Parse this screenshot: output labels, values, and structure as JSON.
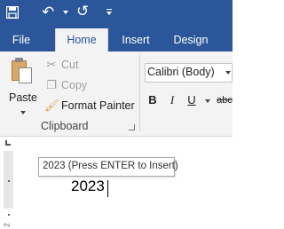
{
  "quick_access": {
    "items": [
      "save-icon",
      "undo-icon",
      "redo-icon",
      "customize-dropdown-icon"
    ],
    "undo_glyph": "↶",
    "redo_glyph": "↺"
  },
  "tabs": [
    {
      "label": "File"
    },
    {
      "label": "Home",
      "active": true
    },
    {
      "label": "Insert"
    },
    {
      "label": "Design"
    }
  ],
  "clipboard": {
    "paste_label": "Paste",
    "cut_label": "Cut",
    "copy_label": "Copy",
    "format_painter_label": "Format Painter",
    "group_label": "Clipboard",
    "cut_glyph": "✂",
    "copy_glyph": "❐",
    "format_painter_glyph": "🖌"
  },
  "font": {
    "name": "Calibri (Body)",
    "bold_label": "B",
    "italic_label": "I",
    "underline_label": "U",
    "strike_label": "abc"
  },
  "document": {
    "autocomplete_tip": "2023  (Press ENTER to Insert)",
    "typed_text": "2023",
    "ruler_number": "2"
  },
  "colors": {
    "accent": "#2b579a",
    "ribbon_bg": "#f3f3f3"
  }
}
